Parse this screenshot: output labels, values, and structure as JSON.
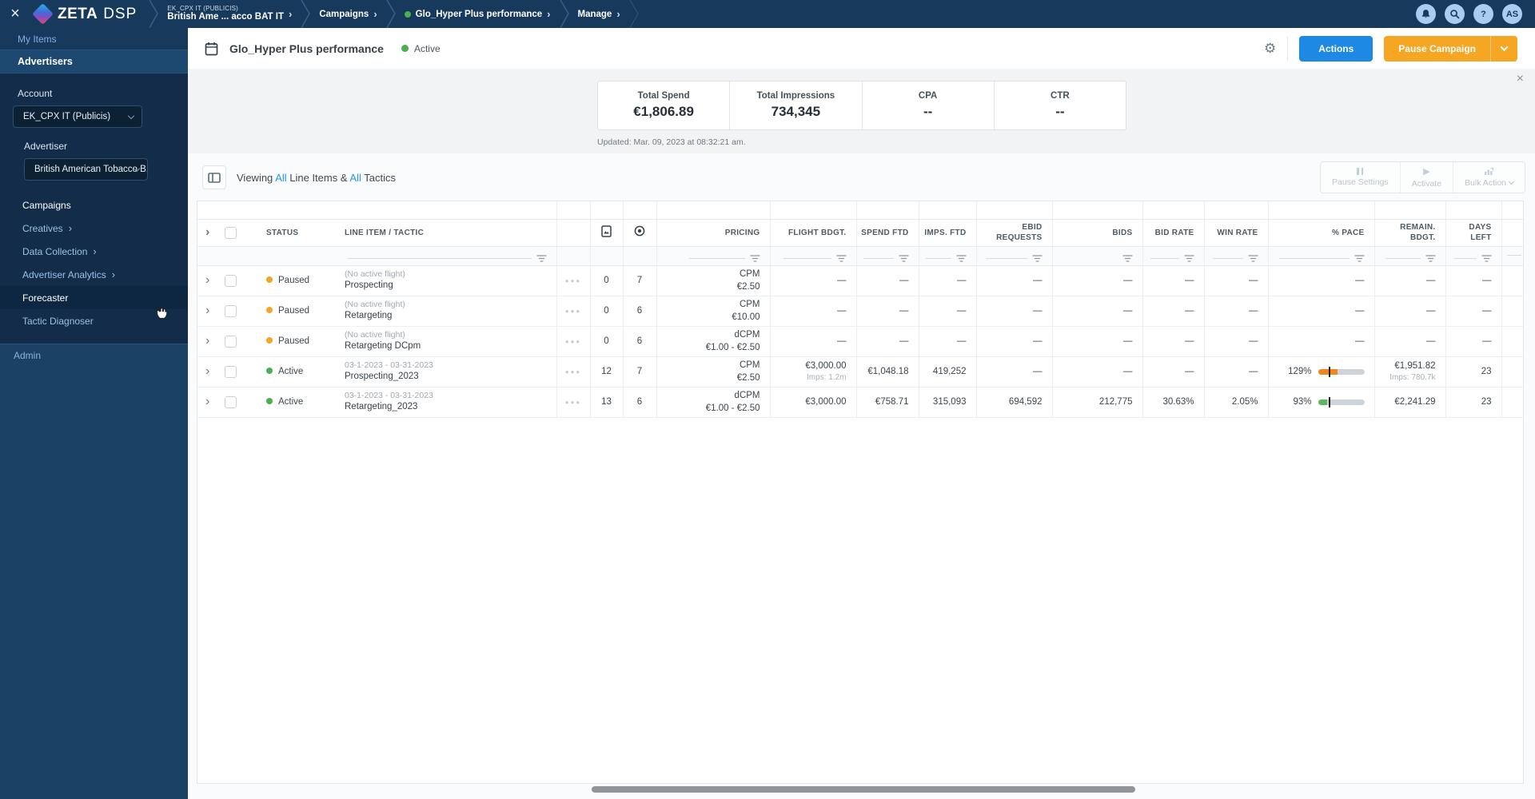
{
  "colors": {
    "accent_blue": "#1e88e5",
    "link_blue": "#2196f3",
    "active_green": "#4caf50",
    "paused_orange": "#f5a623",
    "pace_over_orange": "#f0861f",
    "pace_ok_green": "#5cb85c"
  },
  "topbar": {
    "close": "×",
    "logo_zeta": "ZETA",
    "logo_dsp": "DSP",
    "breadcrumbs": {
      "account_super": "EK_CPX IT (PUBLICIS)",
      "account_label": "British Ame ... acco BAT IT",
      "campaigns": "Campaigns",
      "campaign_name": "Glo_Hyper Plus performance",
      "manage": "Manage"
    },
    "help": "?",
    "avatar_initials": "AS"
  },
  "sidebar": {
    "my_items": "My Items",
    "advertisers": "Advertisers",
    "account_label": "Account",
    "account_value": "EK_CPX IT (Publicis)",
    "advertiser_label": "Advertiser",
    "advertiser_value": "British American Tobacco B...",
    "nav": [
      {
        "label": "Campaigns",
        "chevron": false,
        "active": false,
        "white": true
      },
      {
        "label": "Creatives",
        "chevron": true,
        "active": false,
        "white": false
      },
      {
        "label": "Data Collection",
        "chevron": true,
        "active": false,
        "white": false
      },
      {
        "label": "Advertiser Analytics",
        "chevron": true,
        "active": false,
        "white": false
      },
      {
        "label": "Forecaster",
        "chevron": false,
        "active": true,
        "white": true
      },
      {
        "label": "Tactic Diagnoser",
        "chevron": false,
        "active": false,
        "white": false
      }
    ],
    "admin": "Admin"
  },
  "header": {
    "title": "Glo_Hyper Plus performance",
    "status": "Active",
    "actions_label": "Actions",
    "pause_label": "Pause Campaign"
  },
  "stats": [
    {
      "label": "Total Spend",
      "value": "€1,806.89"
    },
    {
      "label": "Total Impressions",
      "value": "734,345"
    },
    {
      "label": "CPA",
      "value": "--"
    },
    {
      "label": "CTR",
      "value": "--"
    }
  ],
  "updated": "Updated: Mar. 09, 2023 at 08:32:21 am.",
  "toolbar": {
    "viewing": [
      "Viewing ",
      "All",
      " Line Items & ",
      "All",
      " Tactics"
    ],
    "pause_settings": "Pause Settings",
    "activate": "Activate",
    "bulk_action": "Bulk Action"
  },
  "table": {
    "dash": "—",
    "headers": [
      "STATUS",
      "LINE ITEM / TACTIC",
      "PRICING",
      "FLIGHT BDGT.",
      "SPEND FTD",
      "IMPS. FTD",
      "EBID REQUESTS",
      "BIDS",
      "BID RATE",
      "WIN RATE",
      "% PACE",
      "REMAIN. BDGT.",
      "DAYS LEFT"
    ],
    "rows": [
      {
        "status": "Paused",
        "status_color": "#f5a623",
        "flight": "(No active flight)",
        "name": "Prospecting",
        "imgs": "0",
        "tactics": "7",
        "pricing_type": "CPM",
        "pricing": "€2.50",
        "flight_budget": "—",
        "flight_budget_sub": "",
        "spend_ftd": "—",
        "imps_ftd": "—",
        "ebid_requests": "—",
        "bids": "—",
        "bid_rate": "—",
        "win_rate": "—",
        "pace": "—",
        "pace_fill_pct": null,
        "pace_color": "",
        "remaining_budget": "—",
        "remaining_budget_sub": "",
        "days_left": "—"
      },
      {
        "status": "Paused",
        "status_color": "#f5a623",
        "flight": "(No active flight)",
        "name": "Retargeting",
        "imgs": "0",
        "tactics": "6",
        "pricing_type": "CPM",
        "pricing": "€10.00",
        "flight_budget": "—",
        "flight_budget_sub": "",
        "spend_ftd": "—",
        "imps_ftd": "—",
        "ebid_requests": "—",
        "bids": "—",
        "bid_rate": "—",
        "win_rate": "—",
        "pace": "—",
        "pace_fill_pct": null,
        "pace_color": "",
        "remaining_budget": "—",
        "remaining_budget_sub": "",
        "days_left": "—"
      },
      {
        "status": "Paused",
        "status_color": "#f5a623",
        "flight": "(No active flight)",
        "name": "Retargeting DCpm",
        "imgs": "0",
        "tactics": "6",
        "pricing_type": "dCPM",
        "pricing": "€1.00 - €2.50",
        "flight_budget": "—",
        "flight_budget_sub": "",
        "spend_ftd": "—",
        "imps_ftd": "—",
        "ebid_requests": "—",
        "bids": "—",
        "bid_rate": "—",
        "win_rate": "—",
        "pace": "—",
        "pace_fill_pct": null,
        "pace_color": "",
        "remaining_budget": "—",
        "remaining_budget_sub": "",
        "days_left": "—"
      },
      {
        "status": "Active",
        "status_color": "#4caf50",
        "flight": "03-1-2023 - 03-31-2023",
        "name": "Prospecting_2023",
        "imgs": "12",
        "tactics": "7",
        "pricing_type": "CPM",
        "pricing": "€2.50",
        "flight_budget": "€3,000.00",
        "flight_budget_sub": "Imps: 1.2m",
        "spend_ftd": "€1,048.18",
        "imps_ftd": "419,252",
        "ebid_requests": "—",
        "bids": "—",
        "bid_rate": "—",
        "win_rate": "—",
        "pace": "129%",
        "pace_fill_pct": 42,
        "pace_color": "#f0861f",
        "remaining_budget": "€1,951.82",
        "remaining_budget_sub": "Imps: 780.7k",
        "days_left": "23"
      },
      {
        "status": "Active",
        "status_color": "#4caf50",
        "flight": "03-1-2023 - 03-31-2023",
        "name": "Retargeting_2023",
        "imgs": "13",
        "tactics": "6",
        "pricing_type": "dCPM",
        "pricing": "€1.00 - €2.50",
        "flight_budget": "€3,000.00",
        "flight_budget_sub": "",
        "spend_ftd": "€758.71",
        "imps_ftd": "315,093",
        "ebid_requests": "694,592",
        "bids": "212,775",
        "bid_rate": "30.63%",
        "win_rate": "2.05%",
        "pace": "93%",
        "pace_fill_pct": 19,
        "pace_color": "#5cb85c",
        "remaining_budget": "€2,241.29",
        "remaining_budget_sub": "",
        "days_left": "23"
      }
    ]
  }
}
